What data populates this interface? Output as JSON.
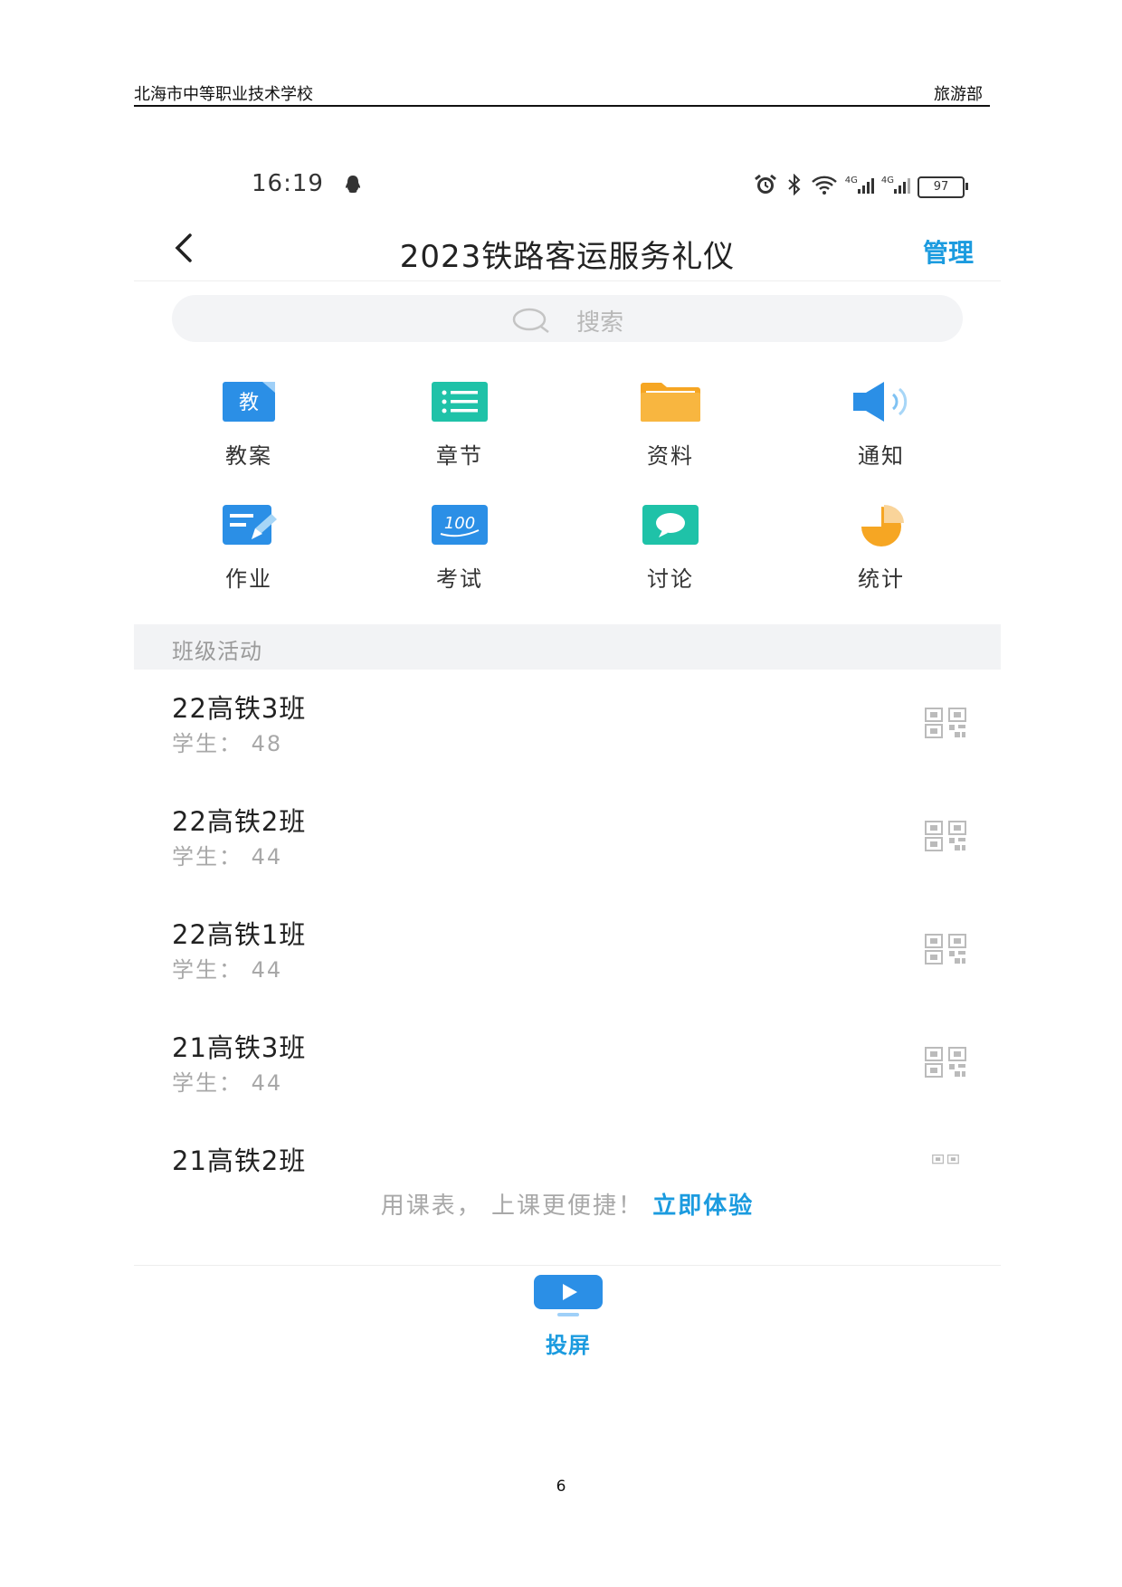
{
  "doc_header": {
    "school": "北海市中等职业技术学校",
    "department": "旅游部"
  },
  "status_bar": {
    "time": "16:19",
    "net1": "4G",
    "net2": "4G",
    "battery": "97"
  },
  "nav": {
    "title": "2023铁路客运服务礼仪",
    "manage": "管理"
  },
  "search": {
    "placeholder": "搜索"
  },
  "grid": {
    "items": [
      {
        "label": "教案",
        "icon": "lesson-plan-icon",
        "glyph": "教",
        "color": "#2b8fe6"
      },
      {
        "label": "章节",
        "icon": "chapter-list-icon",
        "color": "#1fc2a8"
      },
      {
        "label": "资料",
        "icon": "folder-icon",
        "color": "#f6a623"
      },
      {
        "label": "通知",
        "icon": "megaphone-icon",
        "color": "#2b8fe6"
      },
      {
        "label": "作业",
        "icon": "homework-icon",
        "color": "#2b8fe6"
      },
      {
        "label": "考试",
        "icon": "exam-icon",
        "glyph": "100",
        "color": "#2b8fe6"
      },
      {
        "label": "讨论",
        "icon": "discussion-icon",
        "color": "#1fc2a8"
      },
      {
        "label": "统计",
        "icon": "pie-chart-icon",
        "color": "#f6a623"
      }
    ]
  },
  "section": {
    "title": "班级活动"
  },
  "classes": [
    {
      "name": "22高铁3班",
      "students": "学生：  48"
    },
    {
      "name": "22高铁2班",
      "students": "学生：  44"
    },
    {
      "name": "22高铁1班",
      "students": "学生：  44"
    },
    {
      "name": "21高铁3班",
      "students": "学生：  44"
    },
    {
      "name": "21高铁2班"
    }
  ],
  "promo": {
    "text": "用课表，  上课更便捷！",
    "link": "立即体验"
  },
  "bottom": {
    "cast_label": "投屏"
  },
  "page_number": "6"
}
